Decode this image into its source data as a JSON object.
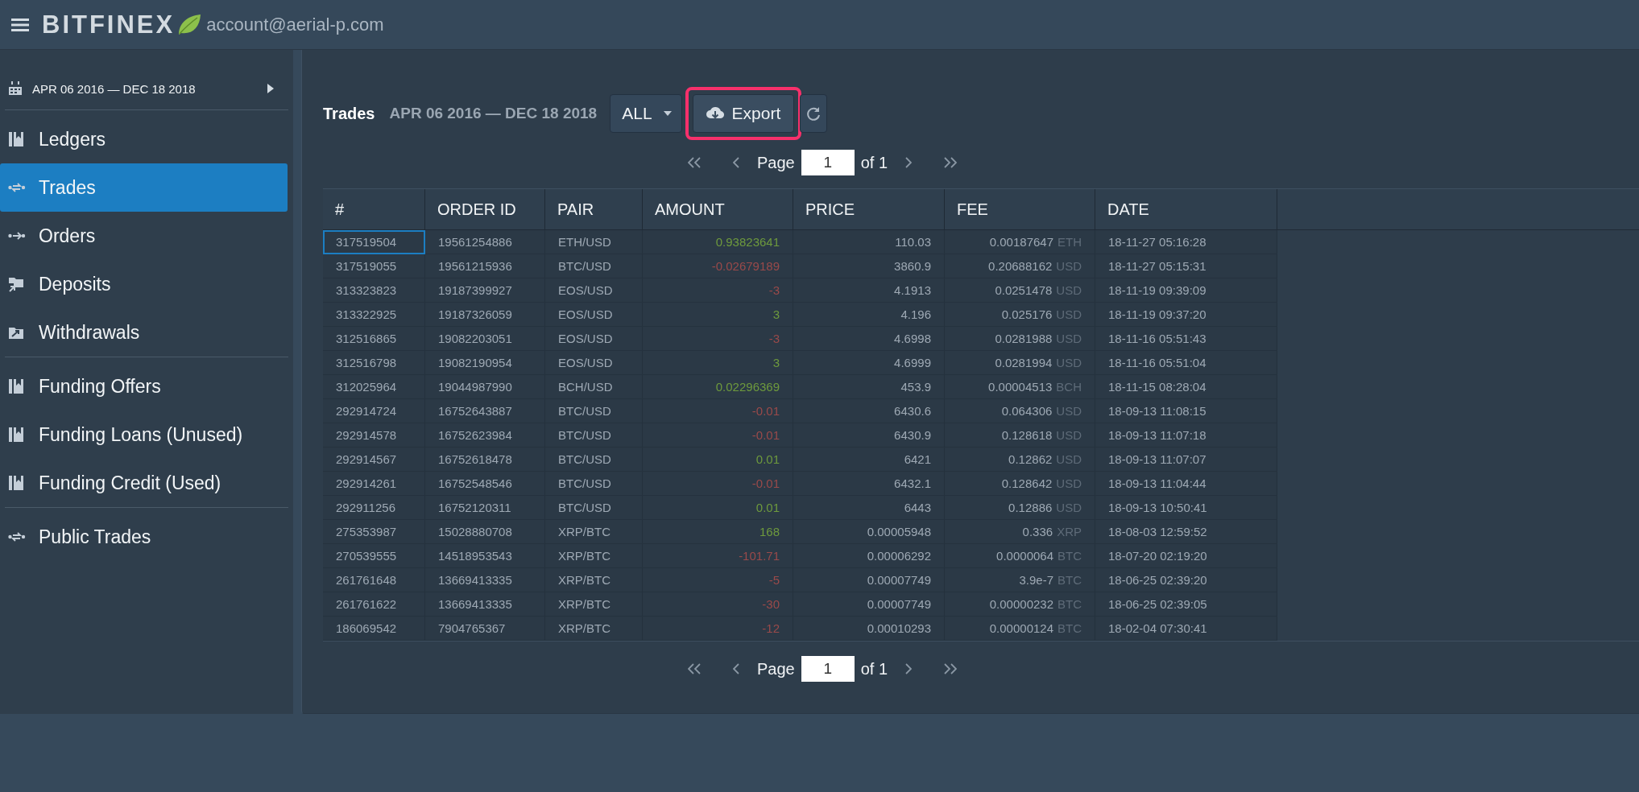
{
  "header": {
    "logo": "BITFINEX",
    "account": "account@aerial-p.com"
  },
  "sidebar": {
    "date_range": "APR 06 2016 — DEC 18 2018",
    "groups": [
      [
        {
          "label": "Ledgers",
          "selected": false
        },
        {
          "label": "Trades",
          "selected": true
        },
        {
          "label": "Orders",
          "selected": false
        },
        {
          "label": "Deposits",
          "selected": false
        },
        {
          "label": "Withdrawals",
          "selected": false
        }
      ],
      [
        {
          "label": "Funding Offers",
          "selected": false
        },
        {
          "label": "Funding Loans (Unused)",
          "selected": false
        },
        {
          "label": "Funding Credit (Used)",
          "selected": false
        }
      ],
      [
        {
          "label": "Public Trades",
          "selected": false
        }
      ]
    ]
  },
  "toolbar": {
    "title": "Trades",
    "date_range": "APR 06 2016 — DEC 18 2018",
    "filter": "ALL",
    "export": "Export",
    "export_highlighted": true
  },
  "pagination_top": {
    "label": "Page",
    "page": "1",
    "of": "of 1"
  },
  "table": {
    "columns": [
      "#",
      "ORDER ID",
      "PAIR",
      "AMOUNT",
      "PRICE",
      "FEE",
      "DATE"
    ],
    "rows": [
      {
        "id": "317519504",
        "order_id": "19561254886",
        "pair": "ETH/USD",
        "amount": "0.93823641",
        "color": "#6e9a3d",
        "price": "110.03",
        "fee": "0.00187647",
        "fee_currency": "ETH",
        "date": "18-11-27 05:16:28",
        "focused": true
      },
      {
        "id": "317519055",
        "order_id": "19561215936",
        "pair": "BTC/USD",
        "amount": "-0.02679189",
        "color": "#9a4a4a",
        "price": "3860.9",
        "fee": "0.20688162",
        "fee_currency": "USD",
        "date": "18-11-27 05:15:31",
        "focused": false
      },
      {
        "id": "313323823",
        "order_id": "19187399927",
        "pair": "EOS/USD",
        "amount": "-3",
        "color": "#9a4a4a",
        "price": "4.1913",
        "fee": "0.0251478",
        "fee_currency": "USD",
        "date": "18-11-19 09:39:09",
        "focused": false
      },
      {
        "id": "313322925",
        "order_id": "19187326059",
        "pair": "EOS/USD",
        "amount": "3",
        "color": "#6e9a3d",
        "price": "4.196",
        "fee": "0.025176",
        "fee_currency": "USD",
        "date": "18-11-19 09:37:20",
        "focused": false
      },
      {
        "id": "312516865",
        "order_id": "19082203051",
        "pair": "EOS/USD",
        "amount": "-3",
        "color": "#9a4a4a",
        "price": "4.6998",
        "fee": "0.0281988",
        "fee_currency": "USD",
        "date": "18-11-16 05:51:43",
        "focused": false
      },
      {
        "id": "312516798",
        "order_id": "19082190954",
        "pair": "EOS/USD",
        "amount": "3",
        "color": "#6e9a3d",
        "price": "4.6999",
        "fee": "0.0281994",
        "fee_currency": "USD",
        "date": "18-11-16 05:51:04",
        "focused": false
      },
      {
        "id": "312025964",
        "order_id": "19044987990",
        "pair": "BCH/USD",
        "amount": "0.02296369",
        "color": "#6e9a3d",
        "price": "453.9",
        "fee": "0.00004513",
        "fee_currency": "BCH",
        "date": "18-11-15 08:28:04",
        "focused": false
      },
      {
        "id": "292914724",
        "order_id": "16752643887",
        "pair": "BTC/USD",
        "amount": "-0.01",
        "color": "#9a4a4a",
        "price": "6430.6",
        "fee": "0.064306",
        "fee_currency": "USD",
        "date": "18-09-13 11:08:15",
        "focused": false
      },
      {
        "id": "292914578",
        "order_id": "16752623984",
        "pair": "BTC/USD",
        "amount": "-0.01",
        "color": "#9a4a4a",
        "price": "6430.9",
        "fee": "0.128618",
        "fee_currency": "USD",
        "date": "18-09-13 11:07:18",
        "focused": false
      },
      {
        "id": "292914567",
        "order_id": "16752618478",
        "pair": "BTC/USD",
        "amount": "0.01",
        "color": "#6e9a3d",
        "price": "6421",
        "fee": "0.12862",
        "fee_currency": "USD",
        "date": "18-09-13 11:07:07",
        "focused": false
      },
      {
        "id": "292914261",
        "order_id": "16752548546",
        "pair": "BTC/USD",
        "amount": "-0.01",
        "color": "#9a4a4a",
        "price": "6432.1",
        "fee": "0.128642",
        "fee_currency": "USD",
        "date": "18-09-13 11:04:44",
        "focused": false
      },
      {
        "id": "292911256",
        "order_id": "16752120311",
        "pair": "BTC/USD",
        "amount": "0.01",
        "color": "#6e9a3d",
        "price": "6443",
        "fee": "0.12886",
        "fee_currency": "USD",
        "date": "18-09-13 10:50:41",
        "focused": false
      },
      {
        "id": "275353987",
        "order_id": "15028880708",
        "pair": "XRP/BTC",
        "amount": "168",
        "color": "#6e9a3d",
        "price": "0.00005948",
        "fee": "0.336",
        "fee_currency": "XRP",
        "date": "18-08-03 12:59:52",
        "focused": false
      },
      {
        "id": "270539555",
        "order_id": "14518953543",
        "pair": "XRP/BTC",
        "amount": "-101.71",
        "color": "#9a4a4a",
        "price": "0.00006292",
        "fee": "0.0000064",
        "fee_currency": "BTC",
        "date": "18-07-20 02:19:20",
        "focused": false
      },
      {
        "id": "261761648",
        "order_id": "13669413335",
        "pair": "XRP/BTC",
        "amount": "-5",
        "color": "#9a4a4a",
        "price": "0.00007749",
        "fee": "3.9e-7",
        "fee_currency": "BTC",
        "date": "18-06-25 02:39:20",
        "focused": false
      },
      {
        "id": "261761622",
        "order_id": "13669413335",
        "pair": "XRP/BTC",
        "amount": "-30",
        "color": "#9a4a4a",
        "price": "0.00007749",
        "fee": "0.00000232",
        "fee_currency": "BTC",
        "date": "18-06-25 02:39:05",
        "focused": false
      },
      {
        "id": "186069542",
        "order_id": "7904765367",
        "pair": "XRP/BTC",
        "amount": "-12",
        "color": "#9a4a4a",
        "price": "0.00010293",
        "fee": "0.00000124",
        "fee_currency": "BTC",
        "date": "18-02-04 07:30:41",
        "focused": false
      }
    ]
  },
  "pagination_bottom": {
    "label": "Page",
    "page": "1",
    "of": "of 1"
  }
}
